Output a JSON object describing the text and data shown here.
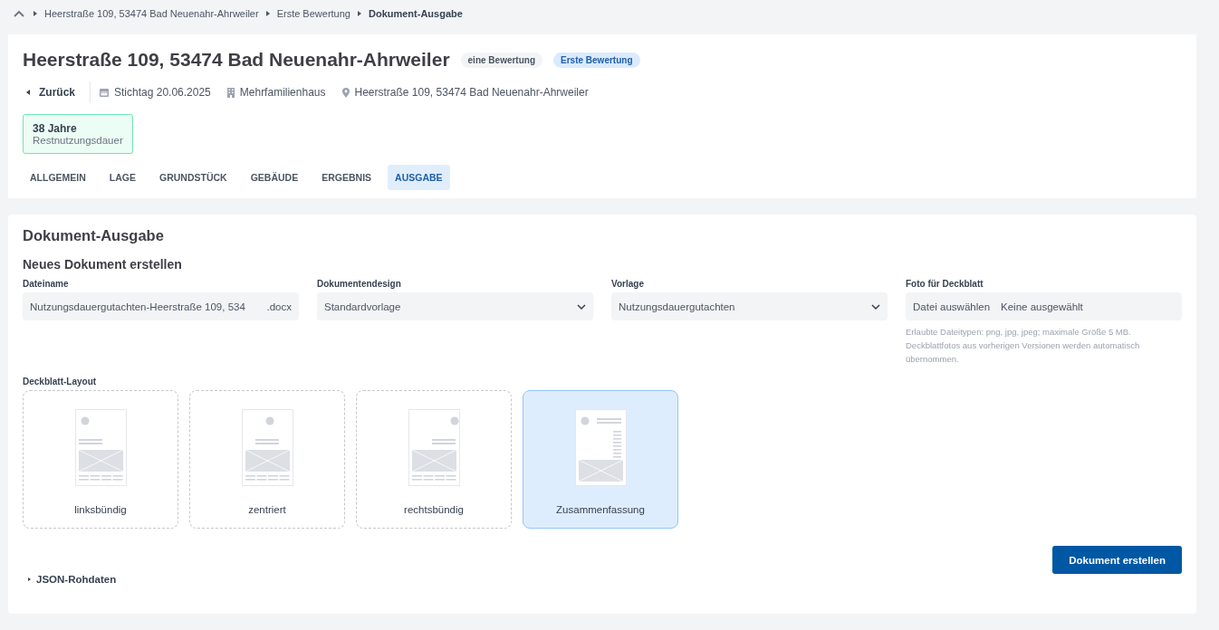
{
  "breadcrumb": {
    "items": [
      "Heerstraße 109, 53474 Bad Neuenahr-Ahrweiler",
      "Erste Bewertung"
    ],
    "current": "Dokument-Ausgabe"
  },
  "header": {
    "title": "Heerstraße 109, 53474 Bad Neuenahr-Ahrweiler",
    "badges": [
      {
        "label": "eine Bewertung",
        "kind": "neutral"
      },
      {
        "label": "Erste Bewertung",
        "kind": "info"
      }
    ],
    "back": "Zurück",
    "meta": [
      {
        "kind": "calendar",
        "text": "Stichtag 20.06.2025"
      },
      {
        "kind": "building",
        "text": "Mehrfamilienhaus"
      },
      {
        "kind": "pin",
        "text": "Heerstraße 109, 53474 Bad Neuenahr-Ahrweiler"
      }
    ],
    "stat": {
      "value": "38 Jahre",
      "label": "Restnutzungsdauer"
    },
    "tabs": [
      {
        "label": "ALLGEMEIN",
        "selected": false
      },
      {
        "label": "LAGE",
        "selected": false
      },
      {
        "label": "GRUNDSTÜCK",
        "selected": false
      },
      {
        "label": "GEBÄUDE",
        "selected": false
      },
      {
        "label": "ERGEBNIS",
        "selected": false
      },
      {
        "label": "AUSGABE",
        "selected": true
      }
    ]
  },
  "output": {
    "title": "Dokument-Ausgabe",
    "subtitle": "Neues Dokument erstellen",
    "fields": [
      {
        "kind": "text",
        "label": "Dateiname",
        "value": "Nutzungsdauergutachten-Heerstraße 109, 534",
        "suffix": ".docx"
      },
      {
        "kind": "select",
        "label": "Dokumentendesign",
        "value": "Standardvorlage"
      },
      {
        "kind": "select",
        "label": "Vorlage",
        "value": "Nutzungsdauergutachten"
      },
      {
        "kind": "file",
        "label": "Foto für Deckblatt",
        "button": "Datei auswählen",
        "value": "Keine ausgewählt",
        "hint": "Erlaubte Dateitypen: png, jpg, jpeg; maximale Größe 5 MB. Deckblattfotos aus vorherigen Versionen werden automatisch übernommen."
      }
    ],
    "layout_label": "Deckblatt-Layout",
    "layouts": [
      {
        "label": "linksbündig",
        "kind": "left",
        "selected": false
      },
      {
        "label": "zentriert",
        "kind": "center",
        "selected": false
      },
      {
        "label": "rechtsbündig",
        "kind": "right",
        "selected": false
      },
      {
        "label": "Zusammenfassung",
        "kind": "summary",
        "selected": true
      }
    ],
    "create_button": "Dokument erstellen",
    "json_toggle": "JSON-Rohdaten"
  }
}
